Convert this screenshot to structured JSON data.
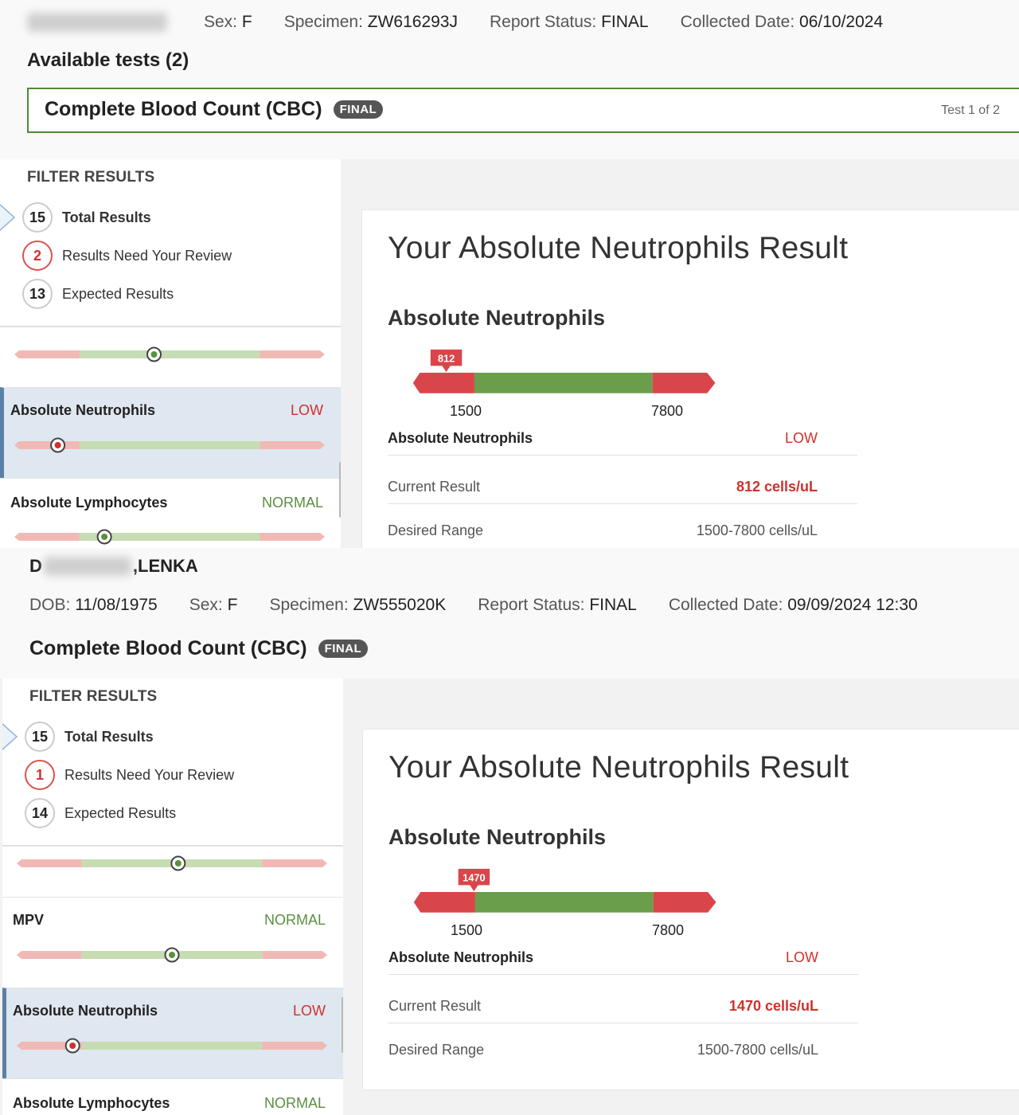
{
  "panel1": {
    "header": {
      "sex_label": "Sex:",
      "sex_value": "F",
      "specimen_label": "Specimen:",
      "specimen_value": "ZW616293J",
      "status_label": "Report Status:",
      "status_value": "FINAL",
      "collected_label": "Collected Date:",
      "collected_value": "06/10/2024"
    },
    "available_tests": "Available tests (2)",
    "test": {
      "name": "Complete Blood Count (CBC)",
      "badge": "FINAL",
      "of": "Test 1 of 2"
    },
    "filter": {
      "title": "FILTER RESULTS",
      "rows": [
        {
          "count": "15",
          "label": "Total Results"
        },
        {
          "count": "2",
          "label": "Results Need Your Review"
        },
        {
          "count": "13",
          "label": "Expected Results"
        }
      ]
    },
    "items": [
      {
        "name": "",
        "status": "",
        "marker_fraction": 0.45
      },
      {
        "name": "Absolute Neutrophils",
        "status": "LOW",
        "marker_fraction": 0.14
      },
      {
        "name": "Absolute Lymphocytes",
        "status": "NORMAL",
        "marker_fraction": 0.29
      }
    ],
    "detail": {
      "title": "Your Absolute Neutrophils Result",
      "subtitle": "Absolute Neutrophils",
      "marker_value": "812",
      "range_low": "1500",
      "range_high": "7800",
      "row_name": "Absolute Neutrophils",
      "row_status": "LOW",
      "current_label": "Current Result",
      "current_value": "812 cells/uL",
      "desired_label": "Desired Range",
      "desired_value": "1500-7800 cells/uL"
    }
  },
  "panel2": {
    "patient_prefix": "D",
    "patient_suffix": ",LENKA",
    "header": {
      "dob_label": "DOB:",
      "dob_value": "11/08/1975",
      "sex_label": "Sex:",
      "sex_value": "F",
      "specimen_label": "Specimen:",
      "specimen_value": "ZW555020K",
      "status_label": "Report Status:",
      "status_value": "FINAL",
      "collected_label": "Collected Date:",
      "collected_value": "09/09/2024 12:30"
    },
    "test": {
      "name": "Complete Blood Count (CBC)",
      "badge": "FINAL"
    },
    "filter": {
      "title": "FILTER RESULTS",
      "rows": [
        {
          "count": "15",
          "label": "Total Results"
        },
        {
          "count": "1",
          "label": "Results Need Your Review"
        },
        {
          "count": "14",
          "label": "Expected Results"
        }
      ]
    },
    "items": [
      {
        "name": "",
        "status": "",
        "marker_fraction": 0.52
      },
      {
        "name": "MPV",
        "status": "NORMAL",
        "marker_fraction": 0.5
      },
      {
        "name": "Absolute Neutrophils",
        "status": "LOW",
        "marker_fraction": 0.18
      },
      {
        "name": "Absolute Lymphocytes",
        "status": "NORMAL",
        "marker_fraction": null
      }
    ],
    "detail": {
      "title": "Your Absolute Neutrophils Result",
      "subtitle": "Absolute Neutrophils",
      "marker_value": "1470",
      "range_low": "1500",
      "range_high": "7800",
      "row_name": "Absolute Neutrophils",
      "row_status": "LOW",
      "current_label": "Current Result",
      "current_value": "1470 cells/uL",
      "desired_label": "Desired Range",
      "desired_value": "1500-7800 cells/uL"
    }
  },
  "colors": {
    "low": "#d0312d",
    "normal": "#5b8f3e",
    "range_green": "#6a9e4a",
    "range_red": "#d9464a",
    "track_green": "#c6dcb2",
    "track_red": "#f0b9b5",
    "accent_border": "#4e8a3a"
  }
}
